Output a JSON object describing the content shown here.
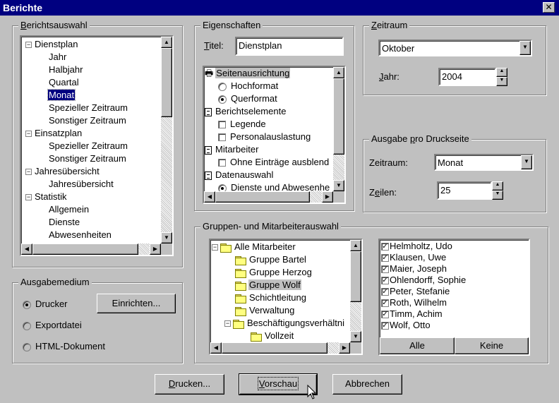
{
  "window": {
    "title": "Berichte"
  },
  "berichtsauswahl": {
    "legend": "Berichtsauswahl",
    "tree": [
      {
        "label": "Dienstplan",
        "expander": "−"
      },
      {
        "label": "Jahr"
      },
      {
        "label": "Halbjahr"
      },
      {
        "label": "Quartal"
      },
      {
        "label": "Monat",
        "selected": true
      },
      {
        "label": "Spezieller Zeitraum"
      },
      {
        "label": "Sonstiger Zeitraum"
      },
      {
        "label": "Einsatzplan",
        "expander": "−"
      },
      {
        "label": "Spezieller Zeitraum"
      },
      {
        "label": "Sonstiger Zeitraum"
      },
      {
        "label": "Jahresübersicht",
        "expander": "−"
      },
      {
        "label": "Jahresübersicht"
      },
      {
        "label": "Statistik",
        "expander": "−"
      },
      {
        "label": "Allgemein"
      },
      {
        "label": "Dienste"
      },
      {
        "label": "Abwesenheiten"
      }
    ]
  },
  "eigenschaften": {
    "legend": "Eigenschaften",
    "titel_label": "Titel:",
    "titel_value": "Dienstplan",
    "items": [
      {
        "kind": "header",
        "icon": "printer-icon",
        "label": "Seitenausrichtung",
        "highlight": true
      },
      {
        "kind": "radio",
        "label": "Hochformat",
        "checked": false
      },
      {
        "kind": "radio",
        "label": "Querformat",
        "checked": true
      },
      {
        "kind": "header",
        "icon": "document-icon",
        "label": "Berichtselemente"
      },
      {
        "kind": "check",
        "label": "Legende",
        "checked": false
      },
      {
        "kind": "check",
        "label": "Personalauslastung",
        "checked": false
      },
      {
        "kind": "header",
        "icon": "document-icon",
        "label": "Mitarbeiter"
      },
      {
        "kind": "check",
        "label": "Ohne Einträge ausblend",
        "checked": false
      },
      {
        "kind": "header",
        "icon": "document-icon",
        "label": "Datenauswahl"
      },
      {
        "kind": "radio",
        "label": "Dienste und Abwesenhe",
        "checked": true
      }
    ]
  },
  "zeitraum": {
    "legend": "Zeitraum",
    "monat": "Oktober",
    "jahr_label": "Jahr:",
    "jahr_value": "2004"
  },
  "ausgabe_druckseite": {
    "legend": "Ausgabe pro Druckseite",
    "zeitraum_label": "Zeitraum:",
    "zeitraum_value": "Monat",
    "zeilen_label": "Zeilen:",
    "zeilen_value": "25"
  },
  "ausgabemedium": {
    "legend": "Ausgabemedium",
    "options": [
      {
        "label": "Drucker",
        "checked": true
      },
      {
        "label": "Exportdatei",
        "checked": false
      },
      {
        "label": "HTML-Dokument",
        "checked": false
      }
    ],
    "einrichten_label": "Einrichten..."
  },
  "gruppen": {
    "legend": "Gruppen- und Mitarbeiterauswahl",
    "tree": [
      {
        "label": "Alle Mitarbeiter",
        "expander": "−"
      },
      {
        "label": "Gruppe Bartel"
      },
      {
        "label": "Gruppe Herzog"
      },
      {
        "label": "Gruppe Wolf",
        "highlight": true
      },
      {
        "label": "Schichtleitung"
      },
      {
        "label": "Verwaltung"
      },
      {
        "label": "Beschäftigungsverhältni",
        "expander": "−"
      },
      {
        "label": "Vollzeit"
      }
    ],
    "mitarbeiter": [
      "Helmholtz, Udo",
      "Klausen, Uwe",
      "Maier, Joseph",
      "Ohlendorff, Sophie",
      "Peter, Stefanie",
      "Roth, Wilhelm",
      "Timm, Achim",
      "Wolf, Otto"
    ],
    "alle_label": "Alle",
    "keine_label": "Keine"
  },
  "buttons": {
    "drucken": "Drucken...",
    "vorschau": "Vorschau",
    "abbrechen": "Abbrechen"
  }
}
